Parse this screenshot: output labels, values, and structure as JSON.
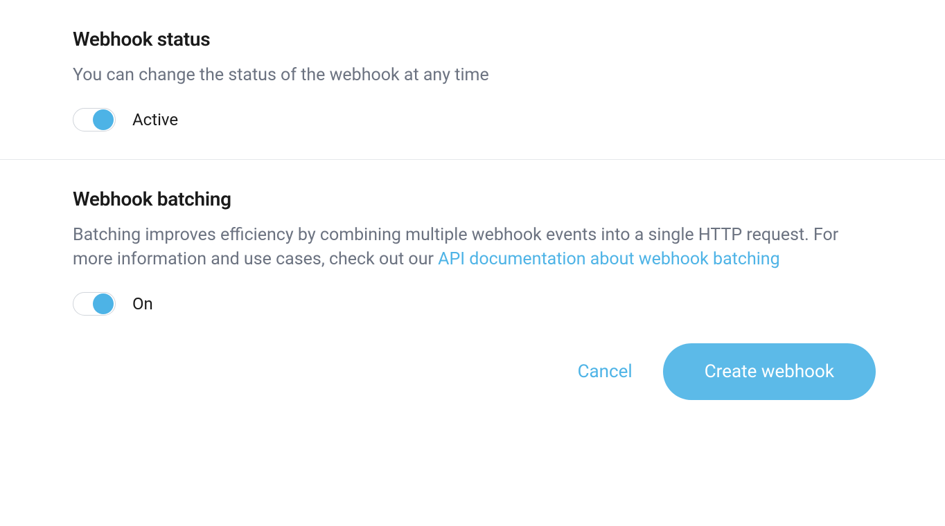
{
  "status": {
    "title": "Webhook status",
    "description": "You can change the status of the webhook at any time",
    "toggle_label": "Active",
    "toggle_on": true
  },
  "batching": {
    "title": "Webhook batching",
    "description_pre": "Batching improves efficiency by combining multiple webhook events into a single HTTP request. For more information and use cases, check out our ",
    "description_link": "API documentation about webhook batching",
    "toggle_label": "On",
    "toggle_on": true
  },
  "actions": {
    "cancel": "Cancel",
    "create": "Create webhook"
  }
}
